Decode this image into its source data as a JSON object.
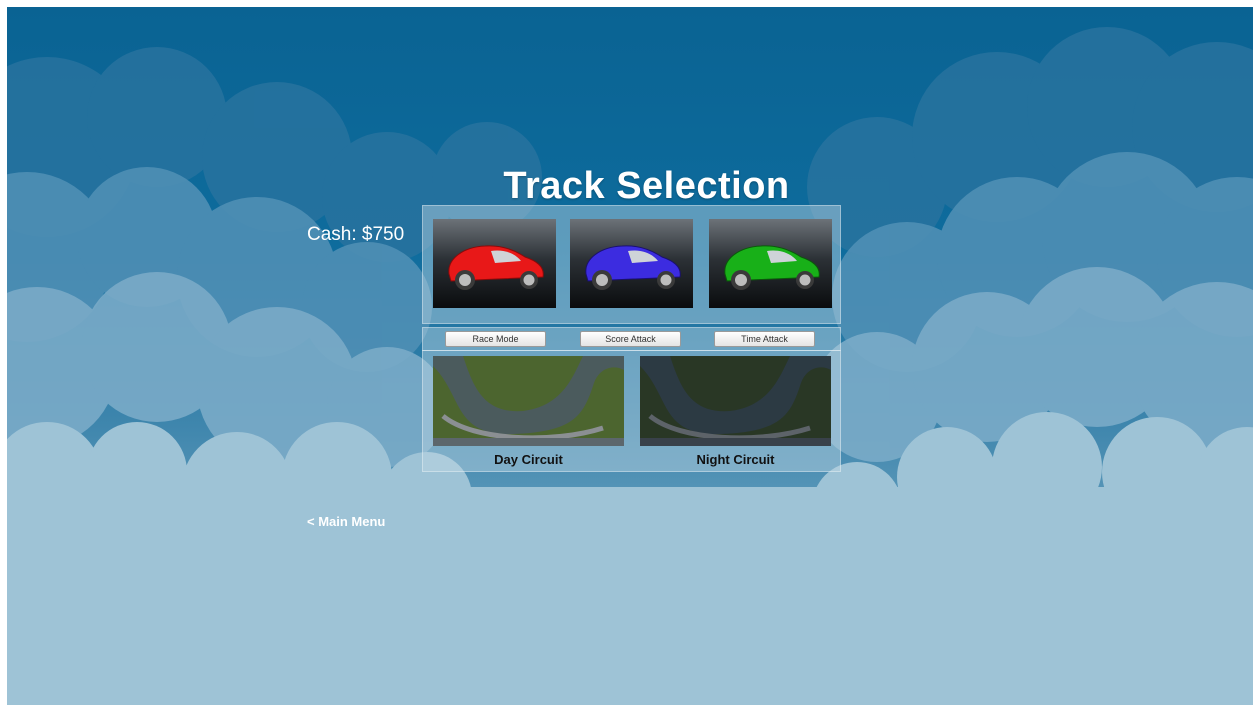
{
  "title": "Track Selection",
  "cash": "Cash: $750",
  "nav": {
    "back_label": "< Main Menu"
  },
  "cars": [
    {
      "color": "#e81818",
      "icon": "red-car-icon"
    },
    {
      "color": "#3c2ce0",
      "icon": "blue-car-icon"
    },
    {
      "color": "#18b018",
      "icon": "green-car-icon"
    }
  ],
  "modes": [
    "Race Mode",
    "Score Attack",
    "Time Attack"
  ],
  "tracks": [
    {
      "label": "Day Circuit",
      "icon": "day-track-thumbnail"
    },
    {
      "label": "Night Circuit",
      "icon": "night-track-thumbnail"
    }
  ],
  "colors": {
    "sky_top": "#0a6393",
    "sky_bottom": "#9ec3d6",
    "text": "#ffffff"
  }
}
